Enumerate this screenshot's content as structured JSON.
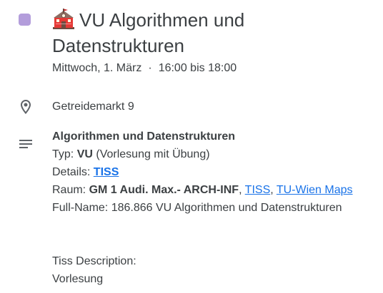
{
  "event": {
    "color": "#b39ddb",
    "icon": "school-icon",
    "title": "VU Algorithmen und Datenstrukturen",
    "date": "Mittwoch, 1. März",
    "separator": "·",
    "time": "16:00 bis 18:00"
  },
  "location": {
    "icon": "location-pin-icon",
    "text": "Getreidemarkt 9"
  },
  "description": {
    "icon": "notes-icon",
    "heading": "Algorithmen und Datenstrukturen",
    "type_label": "Typ: ",
    "type_value": "VU",
    "type_detail": " (Vorlesung mit Übung)",
    "details_label": "Details: ",
    "details_link": "TISS",
    "room_label": "Raum: ",
    "room_value": "GM 1 Audi. Max.- ARCH-INF",
    "room_sep1": ", ",
    "room_link1": "TISS",
    "room_sep2": ", ",
    "room_link2": "TU-Wien Maps",
    "fullname_label": "Full-Name: ",
    "fullname_value": "186.866 VU Algorithmen und Datenstrukturen",
    "tiss_desc_label": "Tiss Description:",
    "tiss_desc_value": "Vorlesung"
  }
}
